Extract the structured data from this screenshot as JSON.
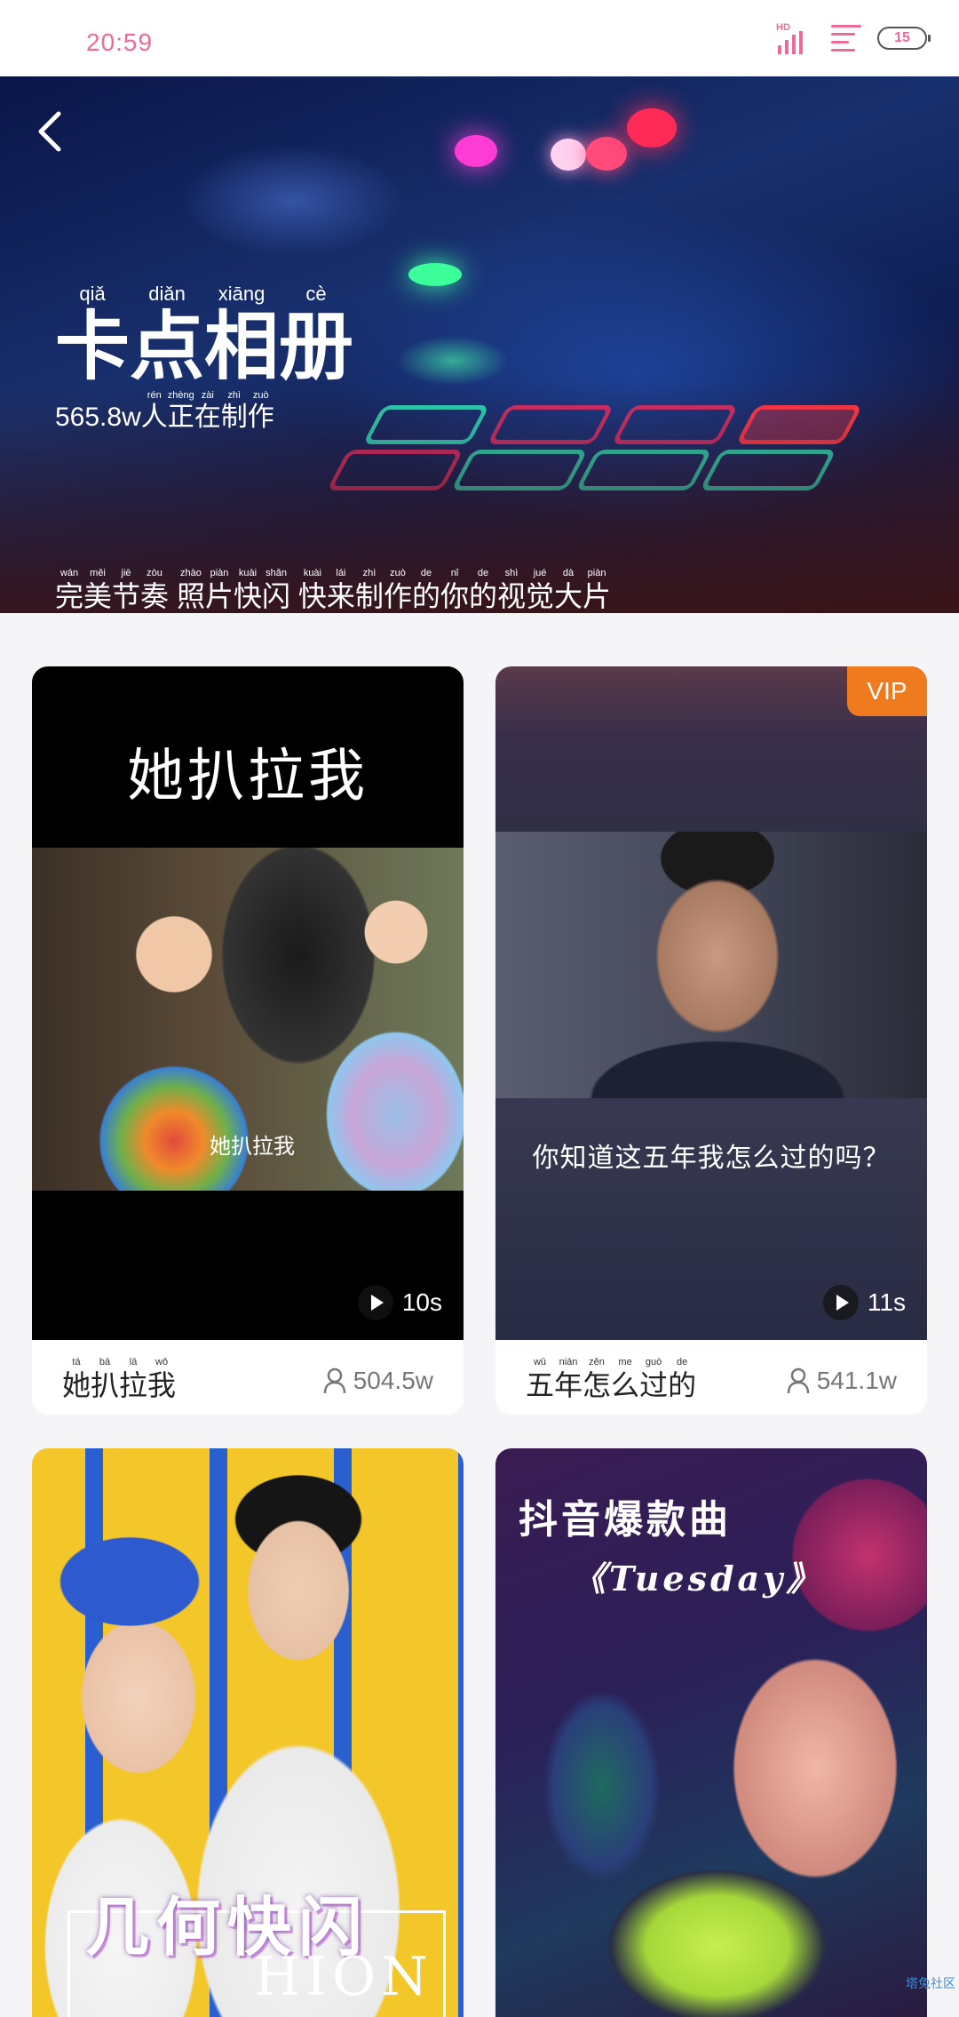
{
  "status_bar": {
    "time": "20:59",
    "network": "HD",
    "battery": "15"
  },
  "hero": {
    "title_chars": [
      {
        "char": "卡",
        "pinyin": "qiǎ"
      },
      {
        "char": "点",
        "pinyin": "diǎn"
      },
      {
        "char": "相",
        "pinyin": "xiāng"
      },
      {
        "char": "册",
        "pinyin": "cè"
      }
    ],
    "maker_count": "565.8w",
    "subtitle_chars": [
      {
        "char": "人",
        "pinyin": "rén"
      },
      {
        "char": "正",
        "pinyin": "zhèng"
      },
      {
        "char": "在",
        "pinyin": "zài"
      },
      {
        "char": "制",
        "pinyin": "zhì"
      },
      {
        "char": "作",
        "pinyin": "zuò"
      }
    ],
    "desc_chars": [
      {
        "char": "完",
        "pinyin": "wán"
      },
      {
        "char": "美",
        "pinyin": "měi"
      },
      {
        "char": "节",
        "pinyin": "jiē"
      },
      {
        "char": "奏",
        "pinyin": "zòu"
      },
      {
        "char": " ",
        "pinyin": ""
      },
      {
        "char": "照",
        "pinyin": "zhào"
      },
      {
        "char": "片",
        "pinyin": "piàn"
      },
      {
        "char": "快",
        "pinyin": "kuài"
      },
      {
        "char": "闪",
        "pinyin": "shǎn"
      },
      {
        "char": " ",
        "pinyin": ""
      },
      {
        "char": "快",
        "pinyin": "kuài"
      },
      {
        "char": "来",
        "pinyin": "lái"
      },
      {
        "char": "制",
        "pinyin": "zhì"
      },
      {
        "char": "作",
        "pinyin": "zuò"
      },
      {
        "char": "的",
        "pinyin": "de"
      },
      {
        "char": "你",
        "pinyin": "nǐ"
      },
      {
        "char": "的",
        "pinyin": "de"
      },
      {
        "char": "视",
        "pinyin": "shì"
      },
      {
        "char": "觉",
        "pinyin": "jué"
      },
      {
        "char": "大",
        "pinyin": "dà"
      },
      {
        "char": "片",
        "pinyin": "piàn"
      }
    ]
  },
  "cards": [
    {
      "thumb_title": "她扒拉我",
      "thumb_caption": "她扒拉我",
      "duration": "10s",
      "name_chars": [
        {
          "char": "她",
          "pinyin": "tā"
        },
        {
          "char": "扒",
          "pinyin": "bā"
        },
        {
          "char": "拉",
          "pinyin": "lā"
        },
        {
          "char": "我",
          "pinyin": "wǒ"
        }
      ],
      "count": "504.5w"
    },
    {
      "vip": "VIP",
      "thumb_caption": "你知道这五年我怎么过的吗？",
      "duration": "11s",
      "name_chars": [
        {
          "char": "五",
          "pinyin": "wǔ"
        },
        {
          "char": "年",
          "pinyin": "nián"
        },
        {
          "char": "怎",
          "pinyin": "zěn"
        },
        {
          "char": "么",
          "pinyin": "me"
        },
        {
          "char": "过",
          "pinyin": "guò"
        },
        {
          "char": "的",
          "pinyin": "de"
        }
      ],
      "count": "541.1w"
    },
    {
      "thumb_title": "几何快闪",
      "thumb_sub": "HION"
    },
    {
      "thumb_title": "抖音爆款曲",
      "thumb_sub": "《Tuesday》",
      "watermark": "塔兔社区"
    }
  ]
}
